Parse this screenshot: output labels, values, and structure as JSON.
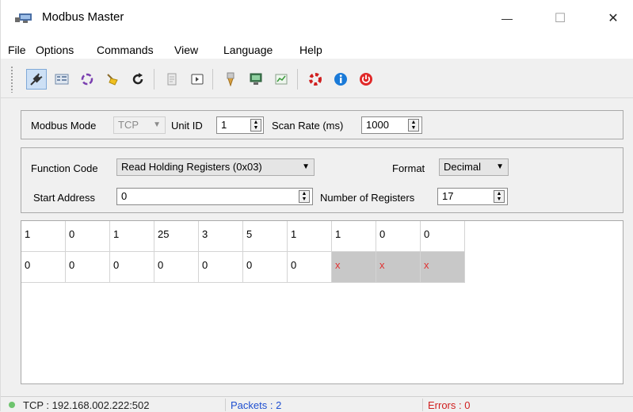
{
  "window": {
    "title": "Modbus Master",
    "icons": {
      "app": "network-icon",
      "minimize": "minimize-icon",
      "maximize": "maximize-icon",
      "close": "close-icon"
    },
    "minimize_glyph": "—",
    "maximize_glyph": "☐",
    "close_glyph": "✕"
  },
  "menu": {
    "items": [
      "File",
      "Options",
      "Commands",
      "View",
      "Language",
      "Help"
    ]
  },
  "toolbar": {
    "buttons": [
      "connect-icon",
      "settings-icon",
      "loop-icon",
      "clear-icon",
      "refresh-icon",
      "document-icon",
      "console-icon",
      "probe-icon",
      "monitor-icon",
      "chart-icon",
      "help-icon",
      "info-icon",
      "power-icon"
    ]
  },
  "connection": {
    "mode_label": "Modbus Mode",
    "mode_value": "TCP",
    "unit_id_label": "Unit ID",
    "unit_id_value": "1",
    "scan_rate_label": "Scan Rate (ms)",
    "scan_rate_value": "1000"
  },
  "function": {
    "code_label": "Function Code",
    "code_value": "Read Holding Registers (0x03)",
    "format_label": "Format",
    "format_value": "Decimal",
    "start_label": "Start Address",
    "start_value": "0",
    "count_label": "Number of Registers",
    "count_value": "17"
  },
  "registers": {
    "rows": [
      [
        "1",
        "0",
        "1",
        "25",
        "3",
        "5",
        "1",
        "1",
        "0",
        "0"
      ],
      [
        "0",
        "0",
        "0",
        "0",
        "0",
        "0",
        "0",
        "x",
        "x",
        "x"
      ]
    ],
    "error_glyph": "x",
    "colors": {
      "error_text": "#e03030",
      "error_bg": "#c8c8c8"
    }
  },
  "status": {
    "connection": "TCP : 192.168.002.222:502",
    "packets": "Packets : 2",
    "errors": "Errors : 0",
    "colors": {
      "ok": "#6ec46e",
      "packets": "#1f4fd0",
      "errors": "#d02020"
    }
  }
}
